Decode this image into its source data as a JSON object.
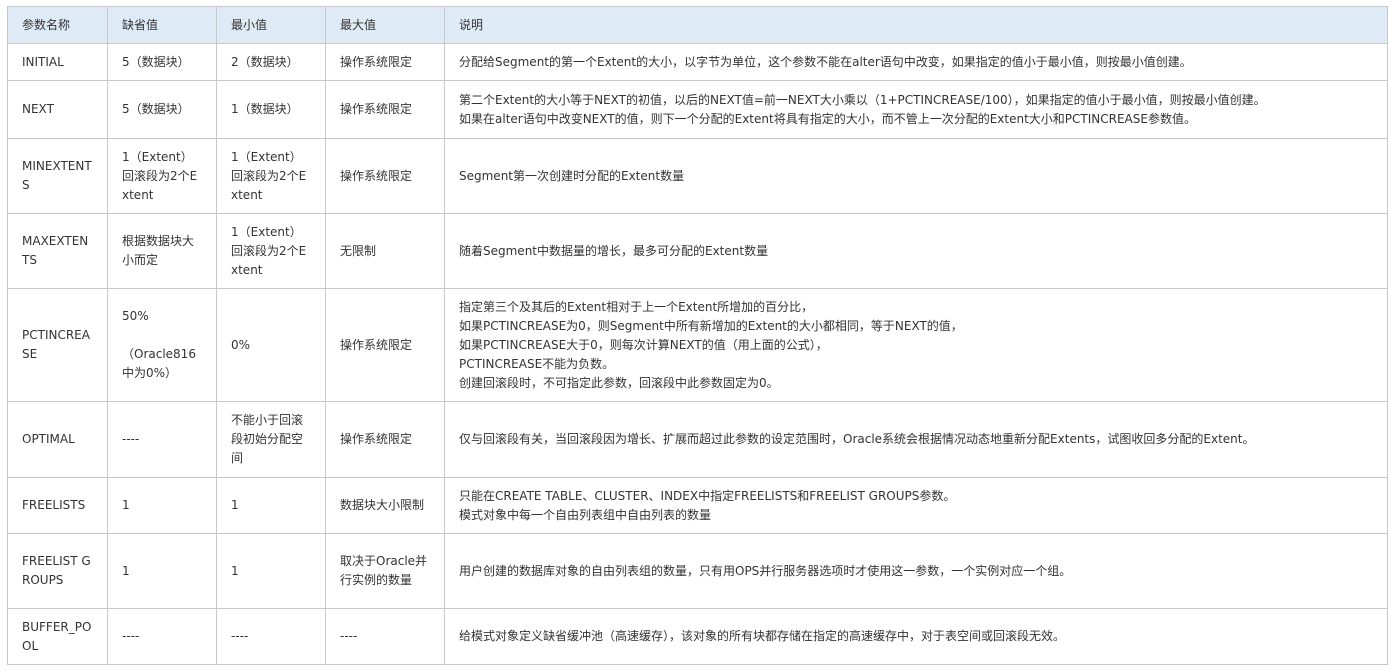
{
  "table": {
    "headers": [
      "参数名称",
      "缺省值",
      "最小值",
      "最大值",
      "说明"
    ],
    "rows": [
      {
        "name": "INITIAL",
        "default": [
          "5（数据块）"
        ],
        "min": [
          "2（数据块）"
        ],
        "max": [
          "操作系统限定"
        ],
        "desc": [
          "分配给Segment的第一个Extent的大小，以字节为单位，这个参数不能在alter语句中改变，如果指定的值小于最小值，则按最小值创建。"
        ]
      },
      {
        "name": "NEXT",
        "default": [
          "5（数据块）"
        ],
        "min": [
          "1（数据块）"
        ],
        "max": [
          "操作系统限定"
        ],
        "desc": [
          "第二个Extent的大小等于NEXT的初值，以后的NEXT值=前一NEXT大小乘以（1+PCTINCREASE/100），如果指定的值小于最小值，则按最小值创建。",
          "如果在alter语句中改变NEXT的值，则下一个分配的Extent将具有指定的大小，而不管上一次分配的Extent大小和PCTINCREASE参数值。"
        ]
      },
      {
        "name": "MINEXTENTS",
        "default": [
          "1（Extent）",
          "回滚段为2个Extent"
        ],
        "min": [
          "1（Extent）",
          "回滚段为2个Extent"
        ],
        "max": [
          "操作系统限定"
        ],
        "desc": [
          "Segment第一次创建时分配的Extent数量"
        ]
      },
      {
        "name": "MAXEXTENTS",
        "default": [
          "根据数据块大小而定"
        ],
        "min": [
          "1（Extent）",
          "回滚段为2个Extent"
        ],
        "max": [
          "无限制"
        ],
        "desc": [
          "随着Segment中数据量的增长，最多可分配的Extent数量"
        ]
      },
      {
        "name": "PCTINCREASE",
        "default": [
          "50%",
          "",
          "（Oracle816中为0%）"
        ],
        "min": [
          "0%"
        ],
        "max": [
          "操作系统限定"
        ],
        "desc": [
          "指定第三个及其后的Extent相对于上一个Extent所增加的百分比，",
          "如果PCTINCREASE为0，则Segment中所有新增加的Extent的大小都相同，等于NEXT的值，",
          "如果PCTINCREASE大于0，则每次计算NEXT的值（用上面的公式），",
          "PCTINCREASE不能为负数。",
          "创建回滚段时，不可指定此参数，回滚段中此参数固定为0。"
        ]
      },
      {
        "name": "OPTIMAL",
        "default": [
          "----"
        ],
        "min": [
          "不能小于回滚段初始分配空间"
        ],
        "max": [
          "操作系统限定"
        ],
        "desc": [
          "仅与回滚段有关，当回滚段因为增长、扩展而超过此参数的设定范围时，Oracle系统会根据情况动态地重新分配Extents，试图收回多分配的Extent。"
        ]
      },
      {
        "name": "FREELISTS",
        "default": [
          "1"
        ],
        "min": [
          "1"
        ],
        "max": [
          "数据块大小限制"
        ],
        "desc": [
          "只能在CREATE TABLE、CLUSTER、INDEX中指定FREELISTS和FREELIST GROUPS参数。",
          "模式对象中每一个自由列表组中自由列表的数量"
        ]
      },
      {
        "name": "FREELIST GROUPS",
        "default": [
          "1"
        ],
        "min": [
          "1"
        ],
        "max": [
          "取决于Oracle并行实例的数量"
        ],
        "desc": [
          "用户创建的数据库对象的自由列表组的数量，只有用OPS并行服务器选项时才使用这一参数，一个实例对应一个组。"
        ]
      },
      {
        "name": "BUFFER_POOL",
        "default": [
          "----"
        ],
        "min": [
          "----"
        ],
        "max": [
          "----"
        ],
        "desc": [
          "给模式对象定义缺省缓冲池（高速缓存），该对象的所有块都存储在指定的高速缓存中，对于表空间或回滚段无效。"
        ]
      }
    ]
  }
}
